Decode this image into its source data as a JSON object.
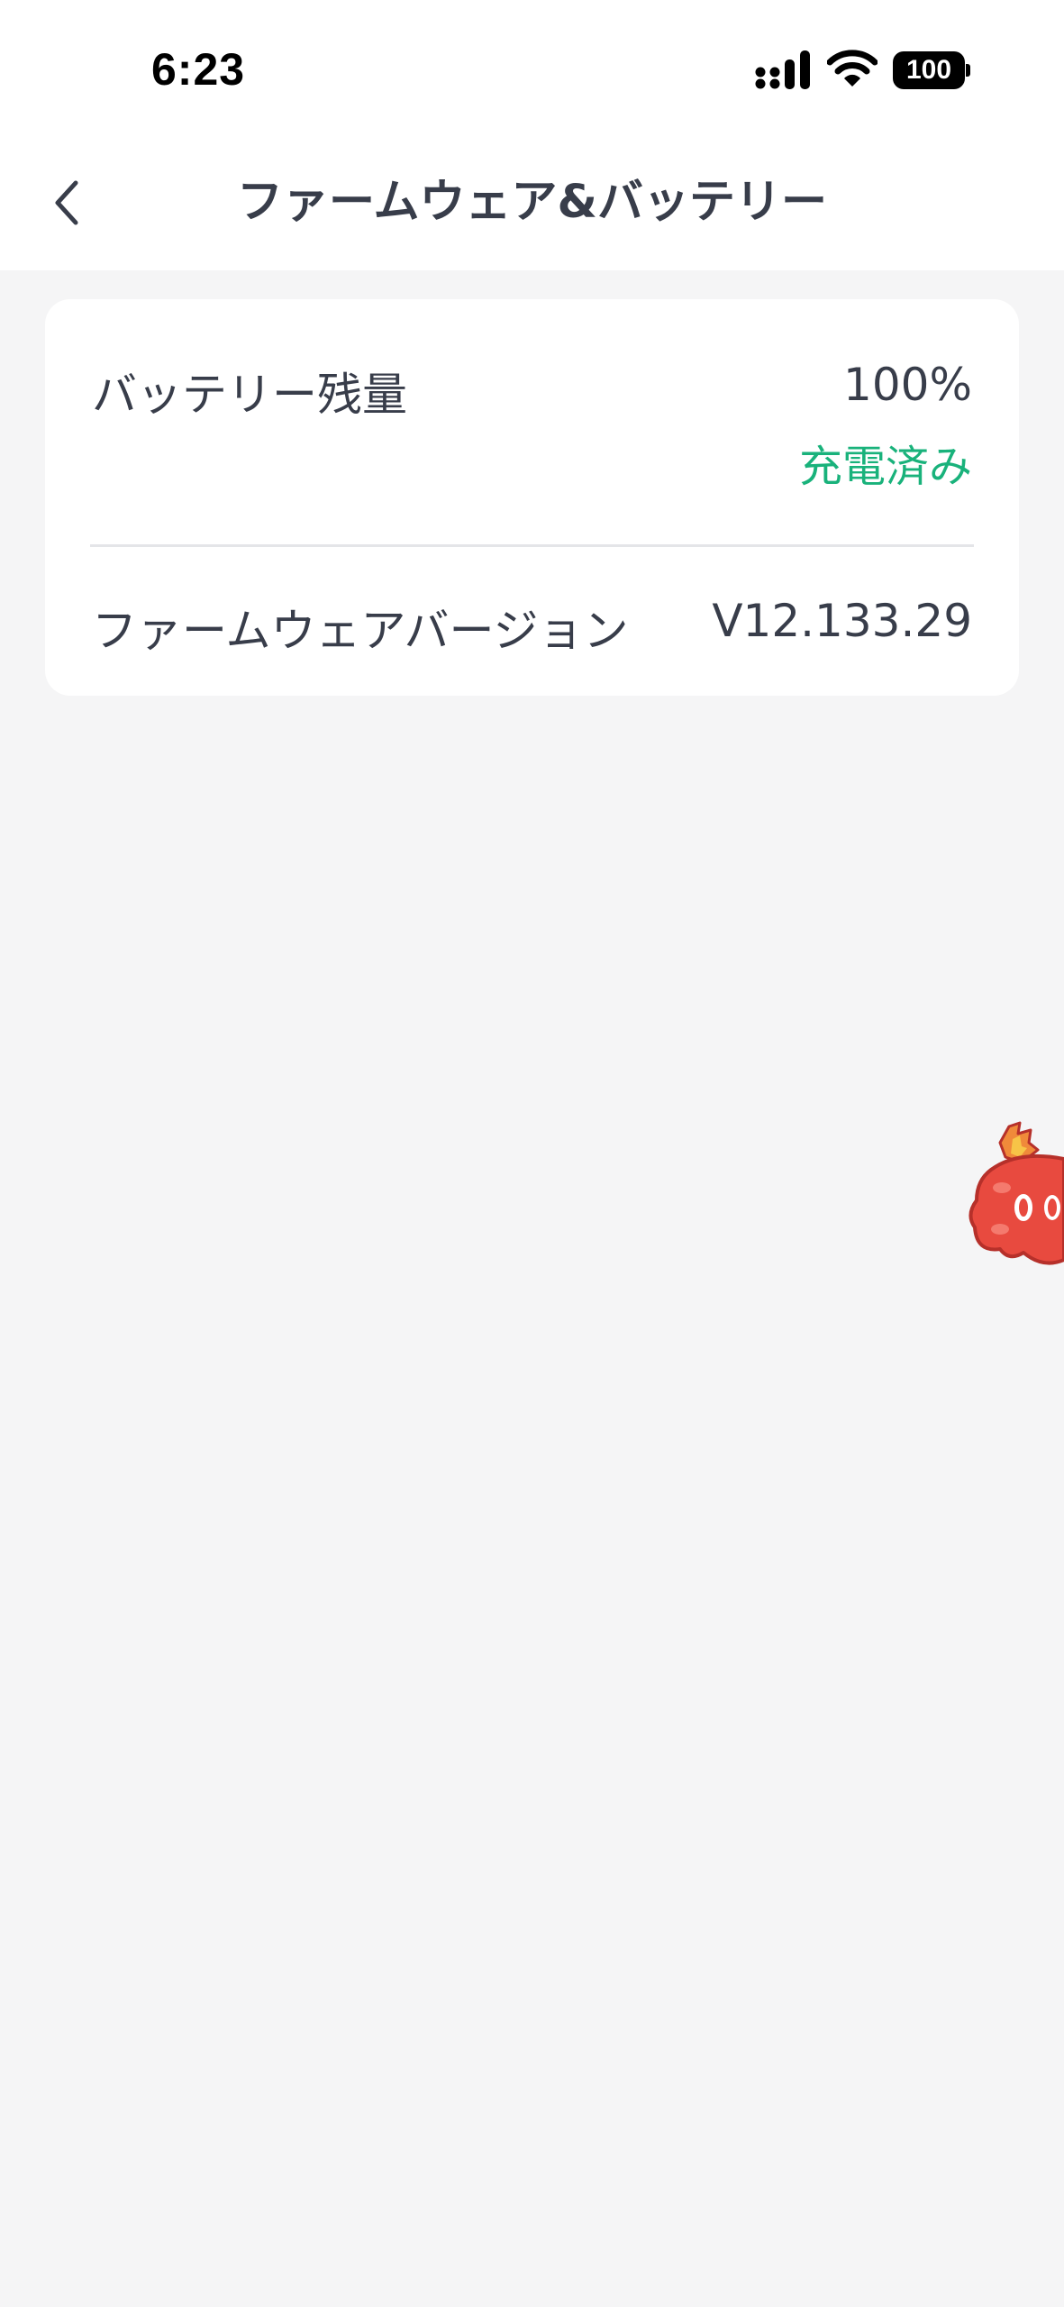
{
  "status_bar": {
    "time": "6:23",
    "battery_level": "100",
    "icons": [
      "signal-icon",
      "wifi-icon",
      "battery-icon"
    ]
  },
  "header": {
    "title": "ファームウェア&バッテリー",
    "back_icon": "chevron-left-icon"
  },
  "info_card": {
    "battery": {
      "label": "バッテリー残量",
      "value": "100%",
      "status": "充電済み"
    },
    "firmware": {
      "label": "ファームウェアバージョン",
      "value": "V12.133.29"
    }
  },
  "colors": {
    "background": "#f5f5f6",
    "card": "#ffffff",
    "text": "#383d4a",
    "accent_green": "#19b27b",
    "mascot_red": "#e84a3f"
  }
}
